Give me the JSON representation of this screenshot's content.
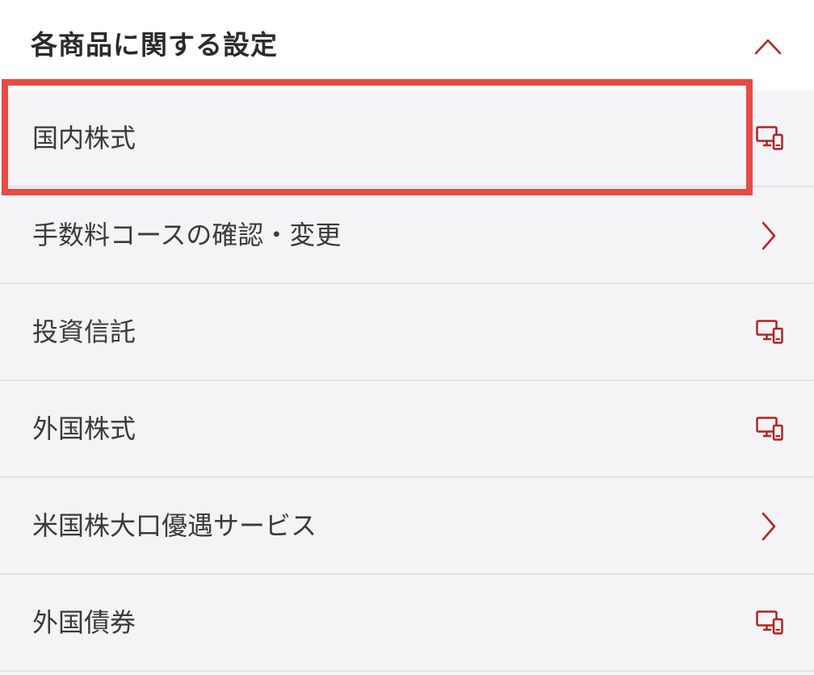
{
  "section": {
    "title": "各商品に関する設定",
    "toggle_icon": "chevron-up-icon"
  },
  "items": [
    {
      "label": "国内株式",
      "icon": "pc-smartphone-icon",
      "highlighted": true
    },
    {
      "label": "手数料コースの確認・変更",
      "icon": "chevron-right-icon"
    },
    {
      "label": "投資信託",
      "icon": "pc-smartphone-icon"
    },
    {
      "label": "外国株式",
      "icon": "pc-smartphone-icon"
    },
    {
      "label": "米国株大口優遇サービス",
      "icon": "chevron-right-icon"
    },
    {
      "label": "外国債券",
      "icon": "pc-smartphone-icon"
    }
  ],
  "colors": {
    "accent": "#b22222",
    "highlight_border": "#e84a45",
    "row_background": "#f4f4f6",
    "header_background": "#ffffff"
  }
}
